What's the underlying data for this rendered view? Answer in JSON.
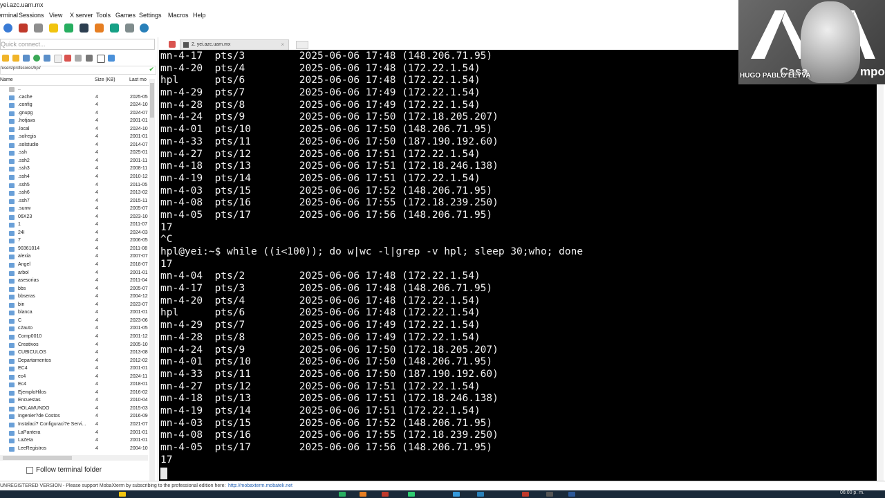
{
  "window": {
    "title": "yei.azc.uam.mx"
  },
  "menu": [
    "Terminal",
    "Sessions",
    "View",
    "X server",
    "Tools",
    "Games",
    "Settings",
    "Macros",
    "Help"
  ],
  "sidebar": {
    "quick_connect_placeholder": "Quick connect...",
    "path": "/users/profesores/hpl/",
    "columns": {
      "name": "Name",
      "size": "Size (KB)",
      "modified": "Last mo"
    },
    "files": [
      {
        "name": "..",
        "size": "",
        "date": ""
      },
      {
        "name": ".cache",
        "size": "4",
        "date": "2025-05"
      },
      {
        "name": ".config",
        "size": "4",
        "date": "2024-10"
      },
      {
        "name": ".gnupg",
        "size": "4",
        "date": "2024-07"
      },
      {
        "name": ".hotjava",
        "size": "4",
        "date": "2001-01"
      },
      {
        "name": ".local",
        "size": "4",
        "date": "2024-10"
      },
      {
        "name": ".solregis",
        "size": "4",
        "date": "2001-01"
      },
      {
        "name": ".solstudio",
        "size": "4",
        "date": "2014-07"
      },
      {
        "name": ".ssh",
        "size": "4",
        "date": "2025-01"
      },
      {
        "name": ".ssh2",
        "size": "4",
        "date": "2001-11"
      },
      {
        "name": ".ssh3",
        "size": "4",
        "date": "2008-11"
      },
      {
        "name": ".ssh4",
        "size": "4",
        "date": "2010-12"
      },
      {
        "name": ".ssh5",
        "size": "4",
        "date": "2011-05"
      },
      {
        "name": ".ssh6",
        "size": "4",
        "date": "2013-02"
      },
      {
        "name": ".ssh7",
        "size": "4",
        "date": "2015-11"
      },
      {
        "name": ".sunw",
        "size": "4",
        "date": "2005-07"
      },
      {
        "name": "06X23",
        "size": "4",
        "date": "2023-10"
      },
      {
        "name": "1",
        "size": "4",
        "date": "2011-07"
      },
      {
        "name": "24I",
        "size": "4",
        "date": "2024-03"
      },
      {
        "name": "7",
        "size": "4",
        "date": "2006-05"
      },
      {
        "name": "90361014",
        "size": "4",
        "date": "2011-08"
      },
      {
        "name": "alexia",
        "size": "4",
        "date": "2007-07"
      },
      {
        "name": "Angel",
        "size": "4",
        "date": "2018-07"
      },
      {
        "name": "arbol",
        "size": "4",
        "date": "2001-01"
      },
      {
        "name": "asesorias",
        "size": "4",
        "date": "2011-04"
      },
      {
        "name": "bbs",
        "size": "4",
        "date": "2005-07"
      },
      {
        "name": "bbseras",
        "size": "4",
        "date": "2004-12"
      },
      {
        "name": "bin",
        "size": "4",
        "date": "2023-07"
      },
      {
        "name": "blanca",
        "size": "4",
        "date": "2001-01"
      },
      {
        "name": "C",
        "size": "4",
        "date": "2023-06"
      },
      {
        "name": "c2auto",
        "size": "4",
        "date": "2001-05"
      },
      {
        "name": "Comp0010",
        "size": "4",
        "date": "2001-12"
      },
      {
        "name": "Creativos",
        "size": "4",
        "date": "2005-10"
      },
      {
        "name": "CUBICULOS",
        "size": "4",
        "date": "2013-08"
      },
      {
        "name": "Departamentos",
        "size": "4",
        "date": "2012-02"
      },
      {
        "name": "EC4",
        "size": "4",
        "date": "2001-01"
      },
      {
        "name": "ec4",
        "size": "4",
        "date": "2024-11"
      },
      {
        "name": "Ec4",
        "size": "4",
        "date": "2018-01"
      },
      {
        "name": "EjemploHilos",
        "size": "4",
        "date": "2016-02"
      },
      {
        "name": "Encuestas",
        "size": "4",
        "date": "2010-04"
      },
      {
        "name": "HOLAMUNDO",
        "size": "4",
        "date": "2015-03"
      },
      {
        "name": "Ingenier?de Costos",
        "size": "4",
        "date": "2016-09"
      },
      {
        "name": "Instalaci? Configuraci?e Servi...",
        "size": "4",
        "date": "2021-07"
      },
      {
        "name": "LaPantera",
        "size": "4",
        "date": "2001-01"
      },
      {
        "name": "LaZeta",
        "size": "4",
        "date": "2001-01"
      },
      {
        "name": "LeeRegistros",
        "size": "4",
        "date": "2004-10"
      }
    ],
    "follow_label": "Follow terminal folder"
  },
  "tabs": {
    "active_label": "2. yei.azc.uam.mx"
  },
  "terminal": {
    "lines": [
      "mn-4-17  pts/3         2025-06-06 17:48 (148.206.71.95)",
      "mn-4-20  pts/4         2025-06-06 17:48 (172.22.1.54)",
      "hpl      pts/6         2025-06-06 17:48 (172.22.1.54)",
      "mn-4-29  pts/7         2025-06-06 17:49 (172.22.1.54)",
      "mn-4-28  pts/8         2025-06-06 17:49 (172.22.1.54)",
      "mn-4-24  pts/9         2025-06-06 17:50 (172.18.205.207)",
      "mn-4-01  pts/10        2025-06-06 17:50 (148.206.71.95)",
      "mn-4-33  pts/11        2025-06-06 17:50 (187.190.192.60)",
      "mn-4-27  pts/12        2025-06-06 17:51 (172.22.1.54)",
      "mn-4-18  pts/13        2025-06-06 17:51 (172.18.246.138)",
      "mn-4-19  pts/14        2025-06-06 17:51 (172.22.1.54)",
      "mn-4-03  pts/15        2025-06-06 17:52 (148.206.71.95)",
      "mn-4-08  pts/16        2025-06-06 17:55 (172.18.239.250)",
      "mn-4-05  pts/17        2025-06-06 17:56 (148.206.71.95)",
      "17",
      "^C",
      "hpl@yei:~$ while ((i<100)); do w|wc -l|grep -v hpl; sleep 30;who; done",
      "17",
      "mn-4-04  pts/2         2025-06-06 17:48 (172.22.1.54)",
      "mn-4-17  pts/3         2025-06-06 17:48 (148.206.71.95)",
      "mn-4-20  pts/4         2025-06-06 17:48 (172.22.1.54)",
      "hpl      pts/6         2025-06-06 17:48 (172.22.1.54)",
      "mn-4-29  pts/7         2025-06-06 17:49 (172.22.1.54)",
      "mn-4-28  pts/8         2025-06-06 17:49 (172.22.1.54)",
      "mn-4-24  pts/9         2025-06-06 17:50 (172.18.205.207)",
      "mn-4-01  pts/10        2025-06-06 17:50 (148.206.71.95)",
      "mn-4-33  pts/11        2025-06-06 17:50 (187.190.192.60)",
      "mn-4-27  pts/12        2025-06-06 17:51 (172.22.1.54)",
      "mn-4-18  pts/13        2025-06-06 17:51 (172.18.246.138)",
      "mn-4-19  pts/14        2025-06-06 17:51 (172.22.1.54)",
      "mn-4-03  pts/15        2025-06-06 17:52 (148.206.71.95)",
      "mn-4-08  pts/16        2025-06-06 17:55 (172.18.239.250)",
      "mn-4-05  pts/17        2025-06-06 17:56 (148.206.71.95)",
      "17"
    ]
  },
  "webcam": {
    "name": "HUGO PABLO LEYVA",
    "caption_left": "Casa",
    "caption_right": "mpo"
  },
  "status": {
    "text": "UNREGISTERED VERSION  -  Please support MobaXterm by subscribing to the professional edition here:",
    "link": "http://mobaxterm.mobatek.net"
  },
  "taskbar": {
    "clock": "06:00 p. m."
  },
  "colors": {
    "terminal_bg": "#000000",
    "terminal_fg": "#f2f2f2",
    "link": "#2462b5"
  }
}
